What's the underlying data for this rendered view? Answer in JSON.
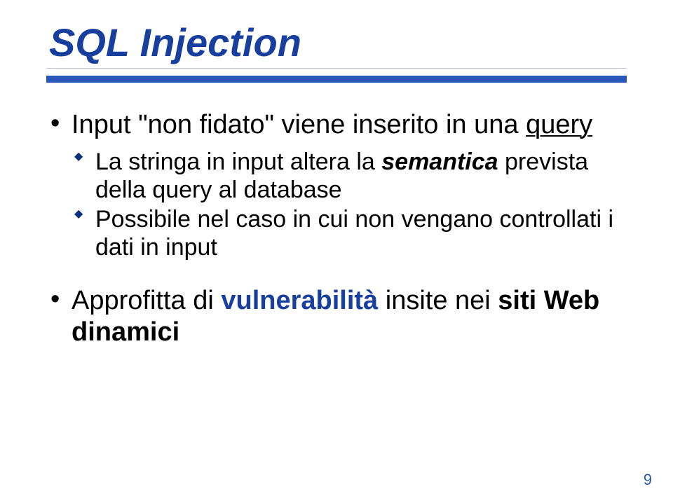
{
  "title": "SQL Injection",
  "bullets": {
    "b1": {
      "pre": "Input \"non fidato\" viene inserito in una ",
      "query": "query"
    },
    "b1a": {
      "pre": "La stringa in input altera la ",
      "sem": "semantica",
      "post": " prevista della query al database"
    },
    "b1b": "Possibile nel caso in cui non vengano controllati i dati in input",
    "b2": {
      "pre": "Approfitta di ",
      "vuln": "vulnerabilità",
      "mid": " insite nei ",
      "siti": "siti Web dinamici"
    }
  },
  "page_number": "9"
}
